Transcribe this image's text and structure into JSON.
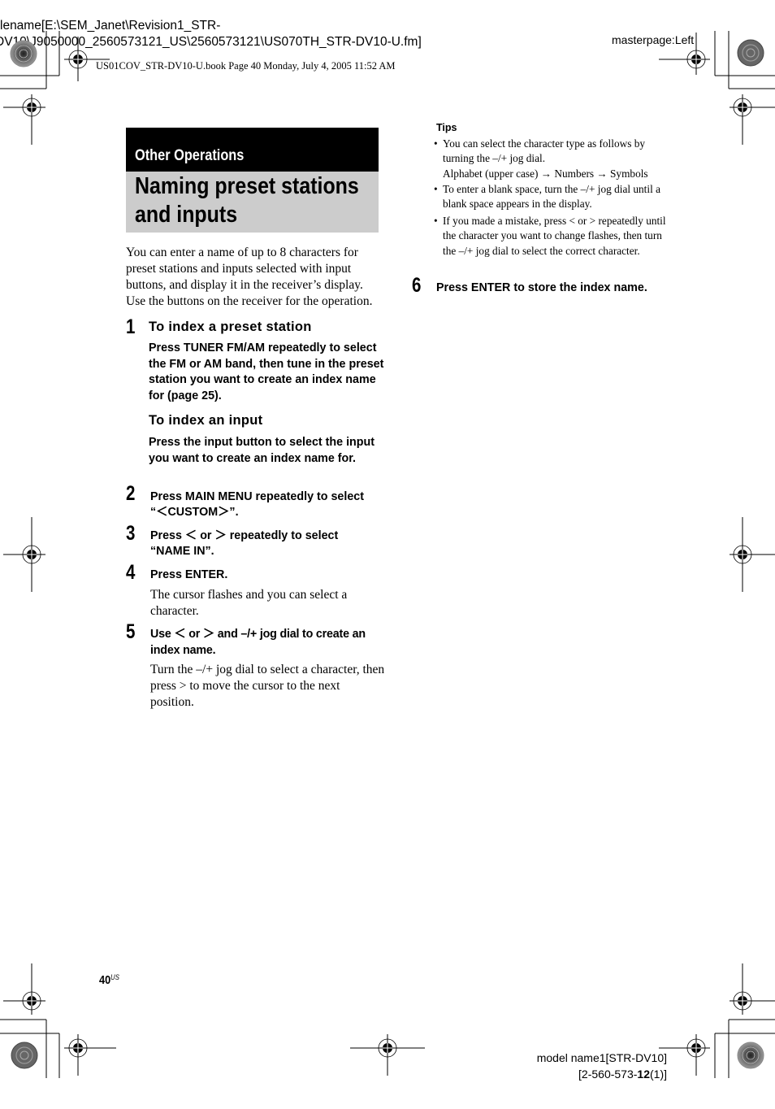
{
  "print_header": {
    "filename_line1": "lename[E:\\SEM_Janet\\Revision1_STR-",
    "filename_line2": "DV10\\J9050000_2560573121_US\\2560573121\\US070TH_STR-DV10-U.fm]",
    "book_info": "US01COV_STR-DV10-U.book  Page 40  Monday, July 4, 2005  11:52 AM",
    "masterpage": "masterpage:Left"
  },
  "section": {
    "category": "Other Operations",
    "title_line1": "Naming preset stations",
    "title_line2": "and inputs"
  },
  "intro": "You can enter a name of up to 8 characters for preset stations and inputs selected with input buttons, and display it in the receiver’s display. Use the buttons on the receiver for the operation.",
  "steps": [
    {
      "number": "1",
      "subsections": [
        {
          "heading": "To index a preset station",
          "instruction": "Press TUNER FM/AM repeatedly to select the FM or AM band, then tune in the preset station you want to create an index name for (page 25)."
        },
        {
          "heading": "To index an input",
          "instruction": "Press the input button to select the input you want to create an index name for."
        }
      ]
    },
    {
      "number": "2",
      "instruction_line1": "Press MAIN MENU repeatedly to select",
      "instruction_line2": "“＜CUSTOM＞”."
    },
    {
      "number": "3",
      "instruction_line1": "Press ＜ or ＞ repeatedly to select",
      "instruction_line2": "“NAME IN”."
    },
    {
      "number": "4",
      "instruction": "Press ENTER.",
      "detail": "The cursor flashes and you can select a character."
    },
    {
      "number": "5",
      "instruction": "Use ＜ or ＞ and –/+ jog dial to create an index name.",
      "detail": "Turn the –/+ jog dial to select a character, then press > to move the cursor to the next position."
    },
    {
      "number": "6",
      "instruction": "Press ENTER to store the index name."
    }
  ],
  "tips": {
    "heading": "Tips",
    "items": [
      {
        "text": "You can select the character type as follows by turning the –/+ jog dial.",
        "sequence": "Alphabet (upper case) → Numbers → Symbols"
      },
      {
        "text": "To enter a blank space, turn the –/+ jog dial until a blank space appears in the display."
      },
      {
        "text": "If you made a mistake, press < or > repeatedly until the character you want to change flashes, then turn the –/+ jog dial to select the correct character."
      }
    ]
  },
  "footer": {
    "page_number": "40",
    "page_suffix": "US",
    "model_line1": "model name1[STR-DV10]",
    "model_prefix": "[2-560-573-",
    "model_bold": "12",
    "model_suffix": "(1)]"
  }
}
